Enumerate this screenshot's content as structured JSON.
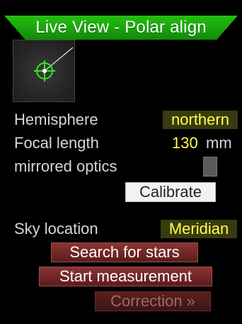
{
  "title": "Live View - Polar align",
  "preview": {
    "icon": "star-target-icon"
  },
  "settings": {
    "hemisphere": {
      "label": "Hemisphere",
      "value": "northern"
    },
    "focal_length": {
      "label": "Focal length",
      "value": "130",
      "unit": "mm"
    },
    "mirrored_optics": {
      "label": "mirrored optics",
      "checked": false
    }
  },
  "calibrate_label": "Calibrate",
  "sky_location": {
    "label": "Sky location",
    "value": "Meridian"
  },
  "buttons": {
    "search_stars": "Search for stars",
    "start_measurement": "Start measurement",
    "correction": "Correction »"
  },
  "colors": {
    "title_green": "#1ea80e",
    "value_yellow": "#ffff4a",
    "button_red": "#7a2a2a"
  }
}
